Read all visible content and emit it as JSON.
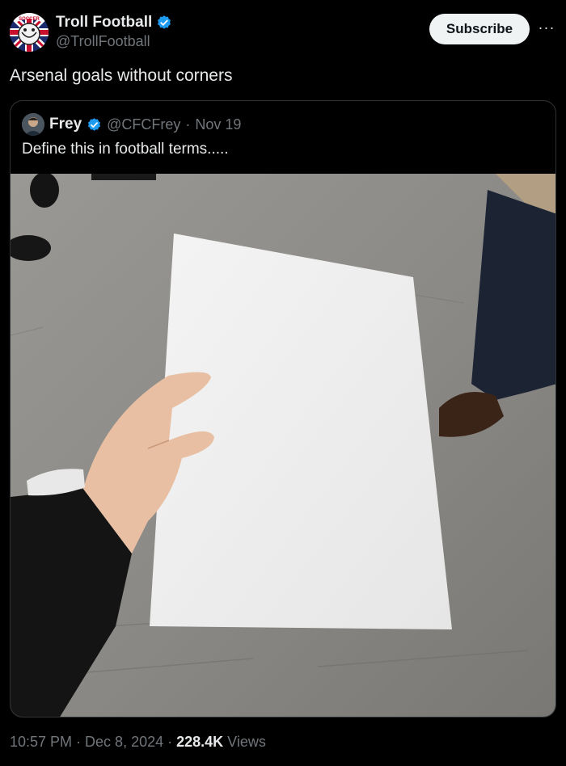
{
  "author": {
    "display_name": "Troll Football",
    "handle": "@TrollFootball",
    "verified_icon": "verified-badge-icon",
    "avatar_text": "SOCCER"
  },
  "actions": {
    "subscribe_label": "Subscribe",
    "more_label": "···"
  },
  "tweet": {
    "text": "Arsenal goals without corners"
  },
  "quoted": {
    "display_name": "Frey",
    "handle": "@CFCFrey",
    "separator": "·",
    "date": "Nov 19",
    "text": "Define this in football terms....."
  },
  "footer": {
    "time": "10:57 PM",
    "sep1": "·",
    "date": "Dec 8, 2024",
    "sep2": "·",
    "views_count": "228.4K",
    "views_label": "Views"
  },
  "colors": {
    "background": "#000000",
    "text": "#e7e9ea",
    "muted": "#71767b",
    "verified": "#1d9bf0",
    "border": "#2f3336"
  }
}
